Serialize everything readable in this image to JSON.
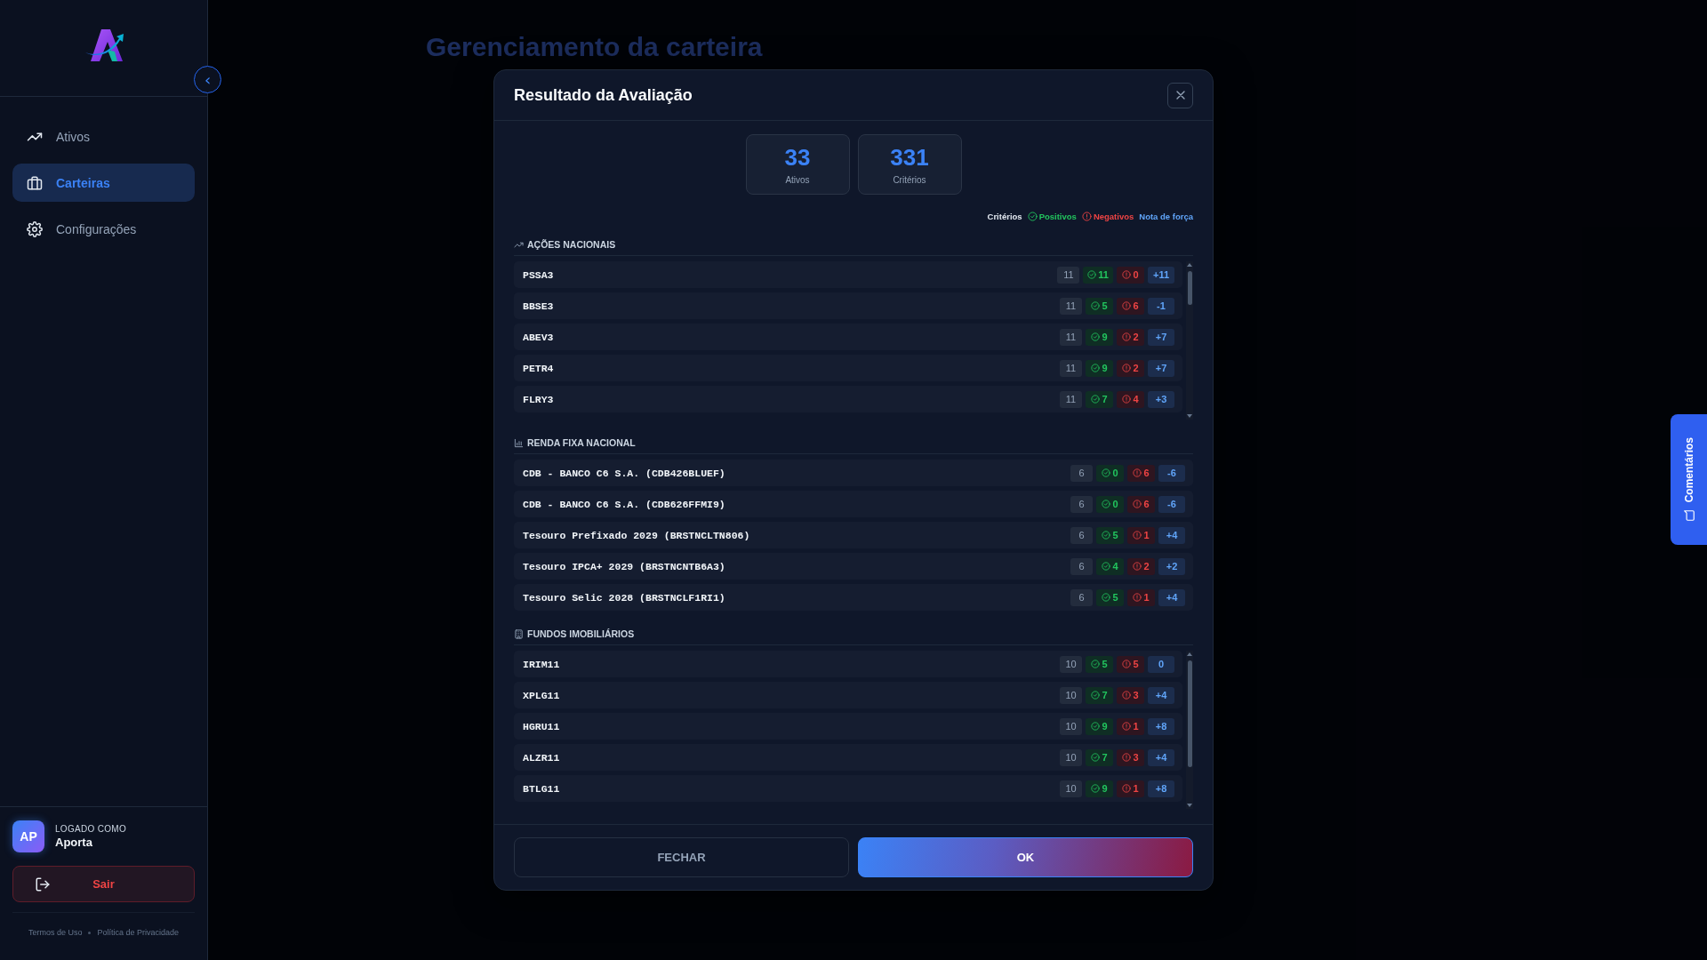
{
  "sidebar": {
    "collapse_button": "‹",
    "nav_items": [
      {
        "label": "Ativos",
        "kind": "trend",
        "selected": false
      },
      {
        "label": "Carteiras",
        "kind": "briefcase",
        "selected": true
      },
      {
        "label": "Configurações",
        "kind": "gear",
        "selected": false
      }
    ],
    "user": {
      "initials": "AP",
      "caption": "LOGADO COMO",
      "name": "Aporta"
    },
    "logout_button": "Sair",
    "footer_links": [
      "Termos de Uso",
      "Política de Privacidade"
    ]
  },
  "background_page": {
    "title": "Gerenciamento da carteira"
  },
  "modal": {
    "title": "Resultado da Avaliação",
    "stats": [
      {
        "value": "33",
        "label": "Ativos"
      },
      {
        "value": "331",
        "label": "Critérios"
      }
    ],
    "legend": {
      "title": "Critérios",
      "positive": "Positivos",
      "negative": "Negativos",
      "score": "Nota de força"
    },
    "sections": [
      {
        "title": "AÇÕES NACIONAIS",
        "kind": "stocks",
        "scrollable": true,
        "rows": [
          {
            "name": "PSSA3",
            "total": "11",
            "positive": "11",
            "negative": "0",
            "score": "+11"
          },
          {
            "name": "BBSE3",
            "total": "11",
            "positive": "5",
            "negative": "6",
            "score": "-1"
          },
          {
            "name": "ABEV3",
            "total": "11",
            "positive": "9",
            "negative": "2",
            "score": "+7"
          },
          {
            "name": "PETR4",
            "total": "11",
            "positive": "9",
            "negative": "2",
            "score": "+7"
          },
          {
            "name": "FLRY3",
            "total": "11",
            "positive": "7",
            "negative": "4",
            "score": "+3"
          }
        ]
      },
      {
        "title": "RENDA FIXA NACIONAL",
        "kind": "fixed_income",
        "scrollable": false,
        "rows": [
          {
            "name": "CDB - BANCO C6 S.A. (CDB426BLUEF)",
            "total": "6",
            "positive": "0",
            "negative": "6",
            "score": "-6"
          },
          {
            "name": "CDB - BANCO C6 S.A. (CDB626FFMI9)",
            "total": "6",
            "positive": "0",
            "negative": "6",
            "score": "-6"
          },
          {
            "name": "Tesouro Prefixado 2029 (BRSTNCLTN806)",
            "total": "6",
            "positive": "5",
            "negative": "1",
            "score": "+4"
          },
          {
            "name": "Tesouro IPCA+ 2029 (BRSTNCNTB6A3)",
            "total": "6",
            "positive": "4",
            "negative": "2",
            "score": "+2"
          },
          {
            "name": "Tesouro Selic 2028 (BRSTNCLF1RI1)",
            "total": "6",
            "positive": "5",
            "negative": "1",
            "score": "+4"
          }
        ]
      },
      {
        "title": "FUNDOS IMOBILIÁRIOS",
        "kind": "real_estate",
        "scrollable": true,
        "rows": [
          {
            "name": "IRIM11",
            "total": "10",
            "positive": "5",
            "negative": "5",
            "score": "0"
          },
          {
            "name": "XPLG11",
            "total": "10",
            "positive": "7",
            "negative": "3",
            "score": "+4"
          },
          {
            "name": "HGRU11",
            "total": "10",
            "positive": "9",
            "negative": "1",
            "score": "+8"
          },
          {
            "name": "ALZR11",
            "total": "10",
            "positive": "7",
            "negative": "3",
            "score": "+4"
          },
          {
            "name": "BTLG11",
            "total": "10",
            "positive": "9",
            "negative": "1",
            "score": "+8"
          }
        ]
      }
    ],
    "buttons": {
      "cancel": "FECHAR",
      "confirm": "OK"
    }
  },
  "feedback_tab": {
    "label": "Comentários"
  }
}
